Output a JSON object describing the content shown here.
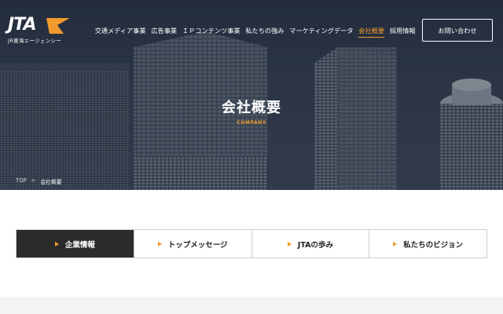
{
  "header": {
    "logo_text": "JTA",
    "logo_sub": "JR東海エージェンシー",
    "nav_items": [
      {
        "label": "交通メディア事業",
        "active": false
      },
      {
        "label": "広告事業",
        "active": false
      },
      {
        "label": "ＩＰコンテンツ事業",
        "active": false
      },
      {
        "label": "私たちの強み",
        "active": false
      },
      {
        "label": "マーケティングデータ",
        "active": false
      },
      {
        "label": "会社概要",
        "active": true
      },
      {
        "label": "採用情報",
        "active": false
      }
    ],
    "contact_label": "お問い合わせ",
    "accent_color": "#f29a2e"
  },
  "hero": {
    "title": "会社概要",
    "subtitle": "COMPANY"
  },
  "breadcrumb": {
    "home": "TOP",
    "separator": ">",
    "current": "会社概要"
  },
  "tabs": [
    {
      "label": "企業情報",
      "active": true
    },
    {
      "label": "トップメッセージ",
      "active": false
    },
    {
      "label": "JTAの歩み",
      "active": false
    },
    {
      "label": "私たちのビジョン",
      "active": false
    }
  ]
}
